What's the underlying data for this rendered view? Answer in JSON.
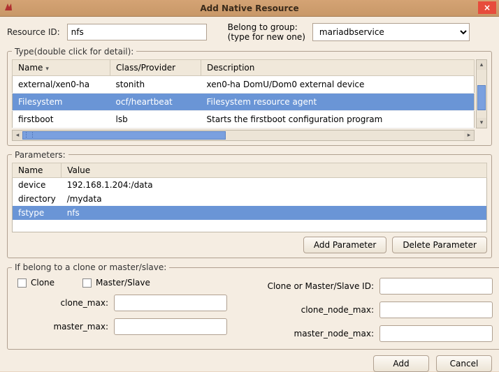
{
  "window": {
    "title": "Add Native Resource",
    "close": "×"
  },
  "form": {
    "resource_id_label": "Resource ID:",
    "resource_id_value": "nfs",
    "belong_label_line1": "Belong to group:",
    "belong_label_line2": "(type for new one)",
    "belong_value": "mariadbservice"
  },
  "type_section": {
    "legend": "Type(double click for detail):",
    "headers": {
      "name": "Name",
      "class": "Class/Provider",
      "desc": "Description"
    },
    "rows": [
      {
        "name": "external/xen0-ha",
        "class": "stonith",
        "desc": "xen0-ha DomU/Dom0 external device",
        "selected": false
      },
      {
        "name": "Filesystem",
        "class": "ocf/heartbeat",
        "desc": "Filesystem resource agent",
        "selected": true
      },
      {
        "name": "firstboot",
        "class": "lsb",
        "desc": "Starts the firstboot configuration program",
        "selected": false
      }
    ]
  },
  "params_section": {
    "legend": "Parameters:",
    "headers": {
      "name": "Name",
      "value": "Value"
    },
    "rows": [
      {
        "name": "device",
        "value": "192.168.1.204:/data",
        "selected": false
      },
      {
        "name": "directory",
        "value": "/mydata",
        "selected": false
      },
      {
        "name": "fstype",
        "value": "nfs",
        "selected": true
      }
    ],
    "add_btn": "Add Parameter",
    "del_btn": "Delete Parameter"
  },
  "clone_section": {
    "legend": "If belong to a clone or master/slave:",
    "clone_chk": "Clone",
    "master_chk": "Master/Slave",
    "clone_id_label": "Clone or Master/Slave ID:",
    "clone_max_label": "clone_max:",
    "clone_node_max_label": "clone_node_max:",
    "master_max_label": "master_max:",
    "master_node_max_label": "master_node_max:"
  },
  "dialog_buttons": {
    "add": "Add",
    "cancel": "Cancel"
  }
}
